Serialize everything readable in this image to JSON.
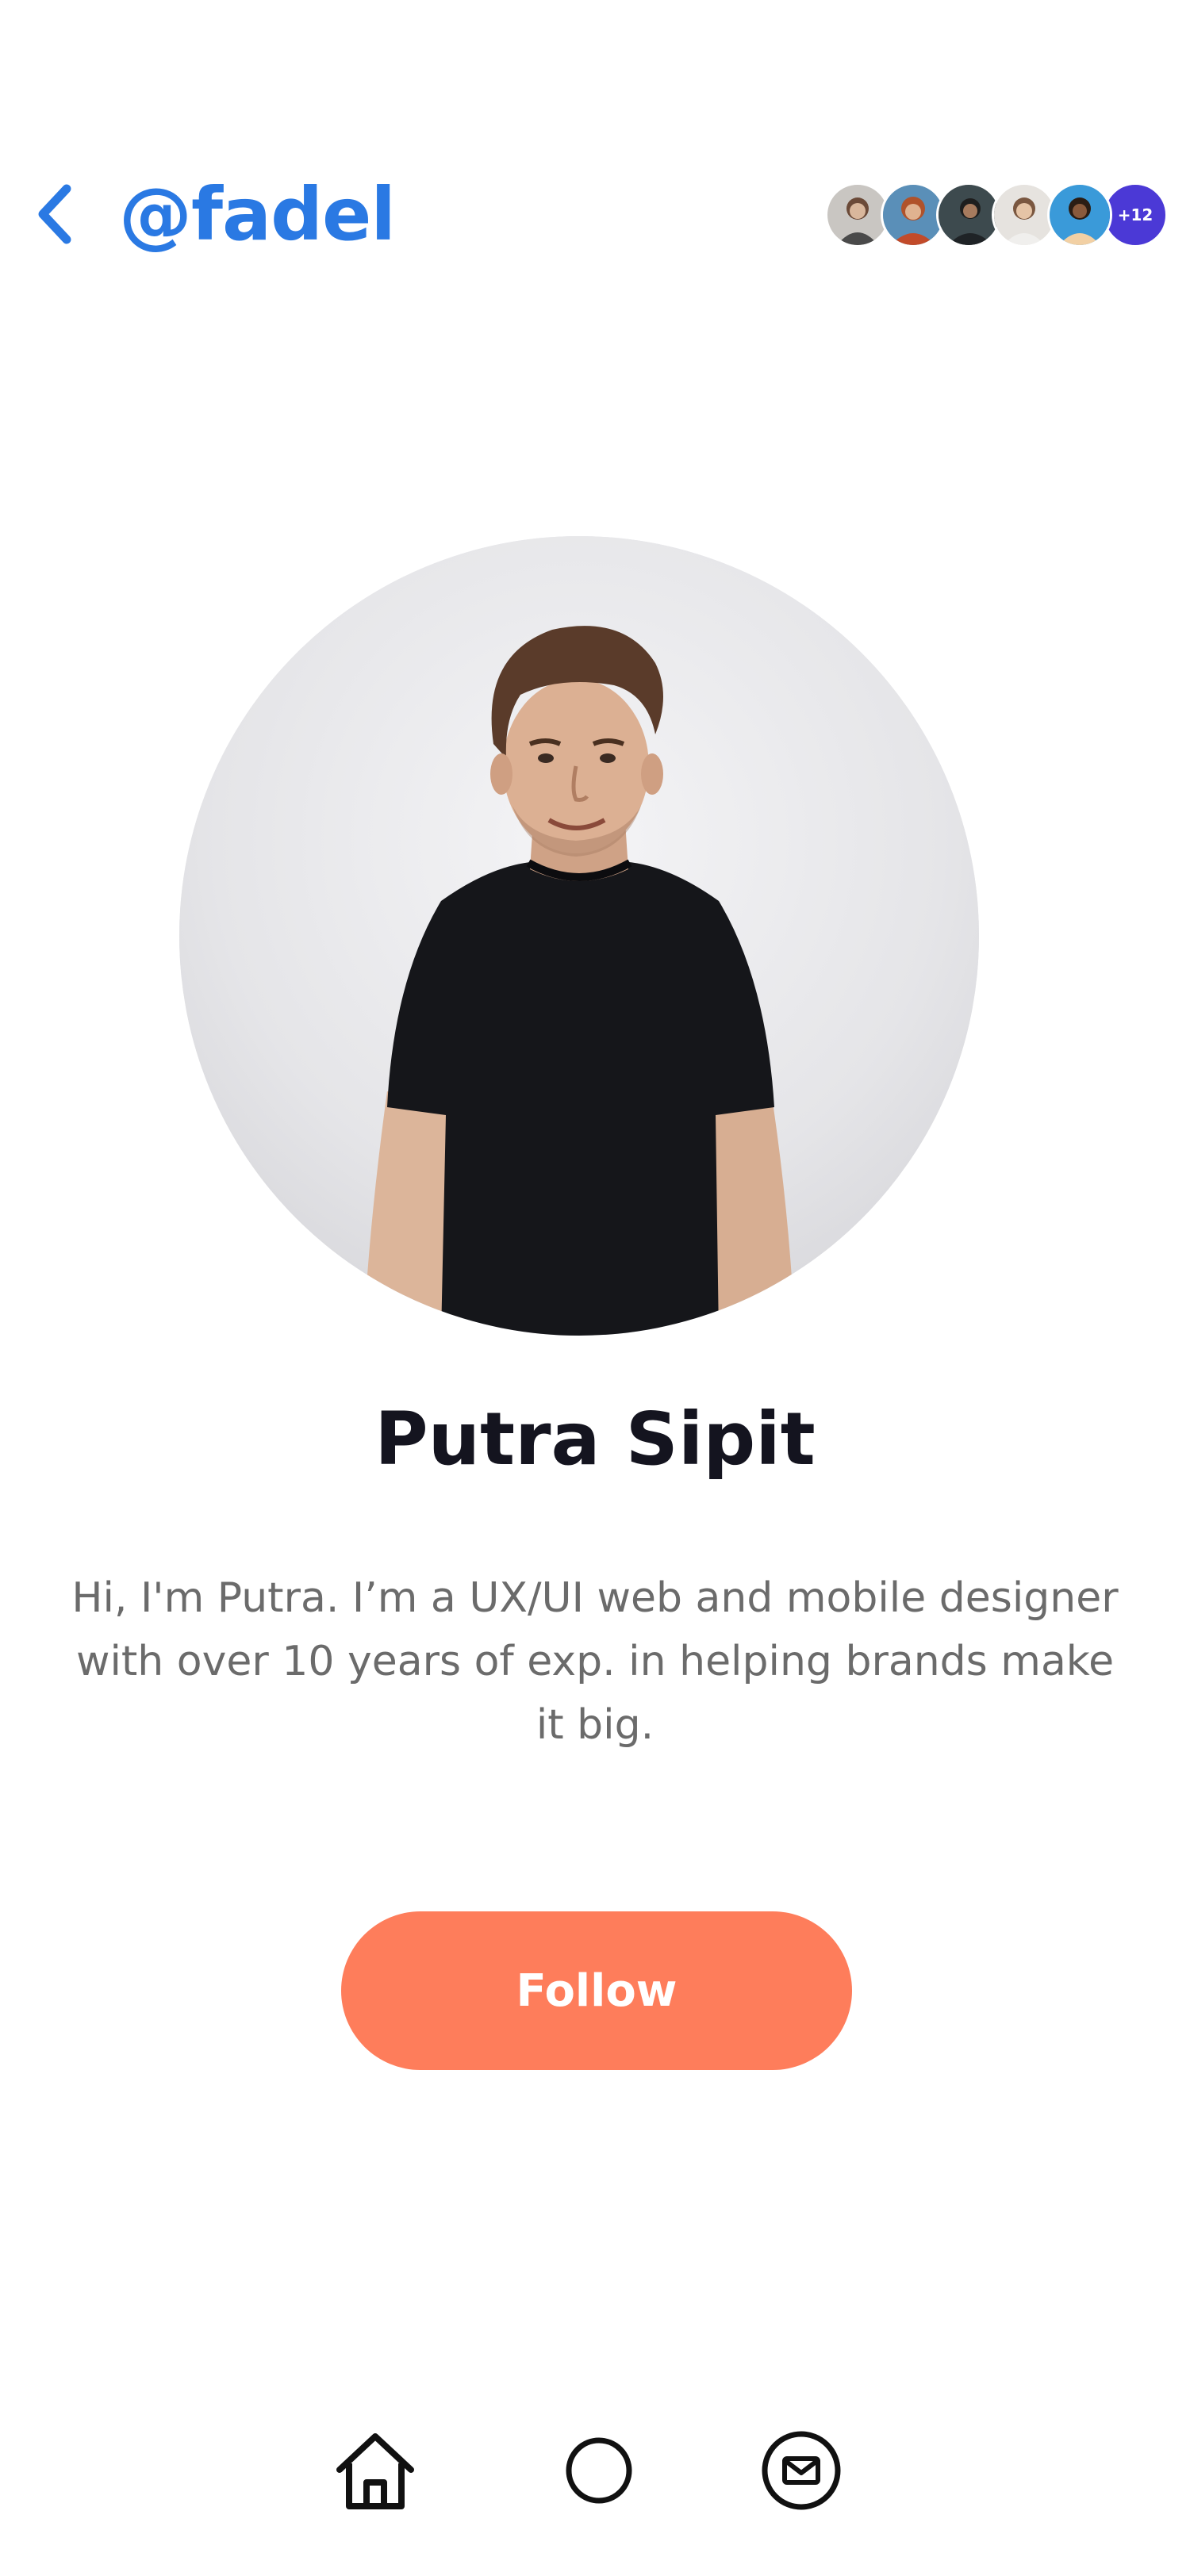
{
  "header": {
    "back_icon": "chevron-left-icon",
    "handle": "@fadel",
    "followers_more": "+12",
    "accent_color": "#2a79e3"
  },
  "profile": {
    "name": "Putra Sipit",
    "bio": "Hi, I'm Putra. I’m a UX/UI web and mobile designer with over 10 years of exp. in helping brands make it big."
  },
  "actions": {
    "follow_label": "Follow",
    "follow_color": "#fe7d5b"
  },
  "bottom_nav": {
    "items": [
      {
        "icon": "home-icon"
      },
      {
        "icon": "circle-icon"
      },
      {
        "icon": "mail-icon"
      }
    ]
  }
}
